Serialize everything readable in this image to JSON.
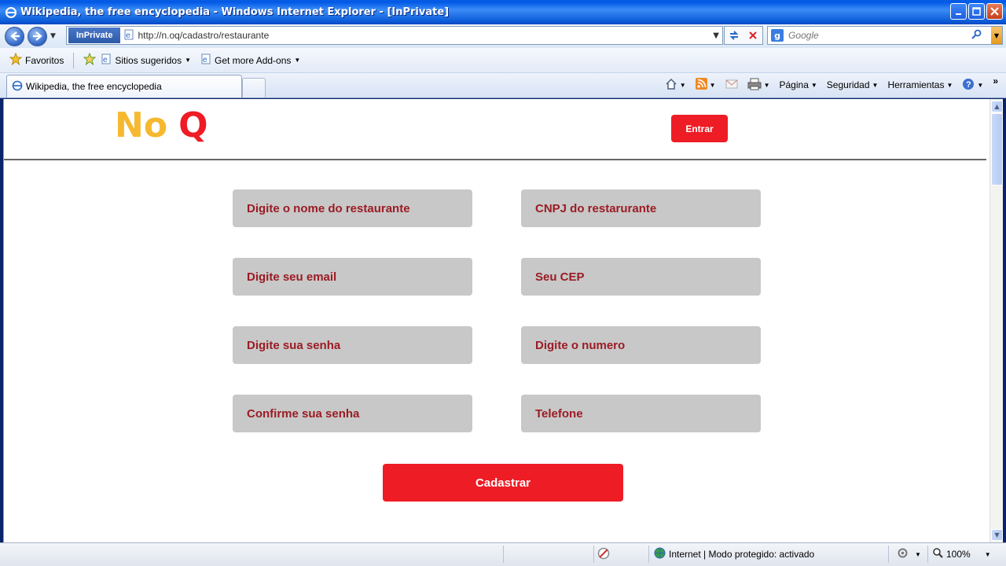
{
  "window": {
    "title": "Wikipedia, the free encyclopedia - Windows Internet Explorer - [InPrivate]"
  },
  "navbar": {
    "inprivate_label": "InPrivate",
    "url": "http://n.oq/cadastro/restaurante",
    "search_placeholder": "Google"
  },
  "favorites_bar": {
    "favorites_label": "Favoritos",
    "items": [
      "Sitios sugeridos",
      "Get more Add-ons"
    ]
  },
  "tabs": {
    "active_tab_title": "Wikipedia, the free encyclopedia"
  },
  "command_bar": {
    "page_label": "Página",
    "safety_label": "Seguridad",
    "tools_label": "Herramientas"
  },
  "page": {
    "logo": {
      "part1": "No",
      "part2": "Q",
      "color_part1": "#f6b82e",
      "color_part2": "#ee1c25"
    },
    "login_button": "Entrar",
    "fields_left": [
      "Digite o nome do restaurante",
      "Digite seu email",
      "Digite sua senha",
      "Confirme sua senha"
    ],
    "fields_right": [
      "CNPJ do restarurante",
      "Seu CEP",
      "Digite o numero",
      "Telefone"
    ],
    "submit_button": "Cadastrar",
    "accent_color": "#ee1c25",
    "field_text_color": "#9b1c24"
  },
  "statusbar": {
    "zone_text": "Internet | Modo protegido: activado",
    "zoom": "100%"
  }
}
